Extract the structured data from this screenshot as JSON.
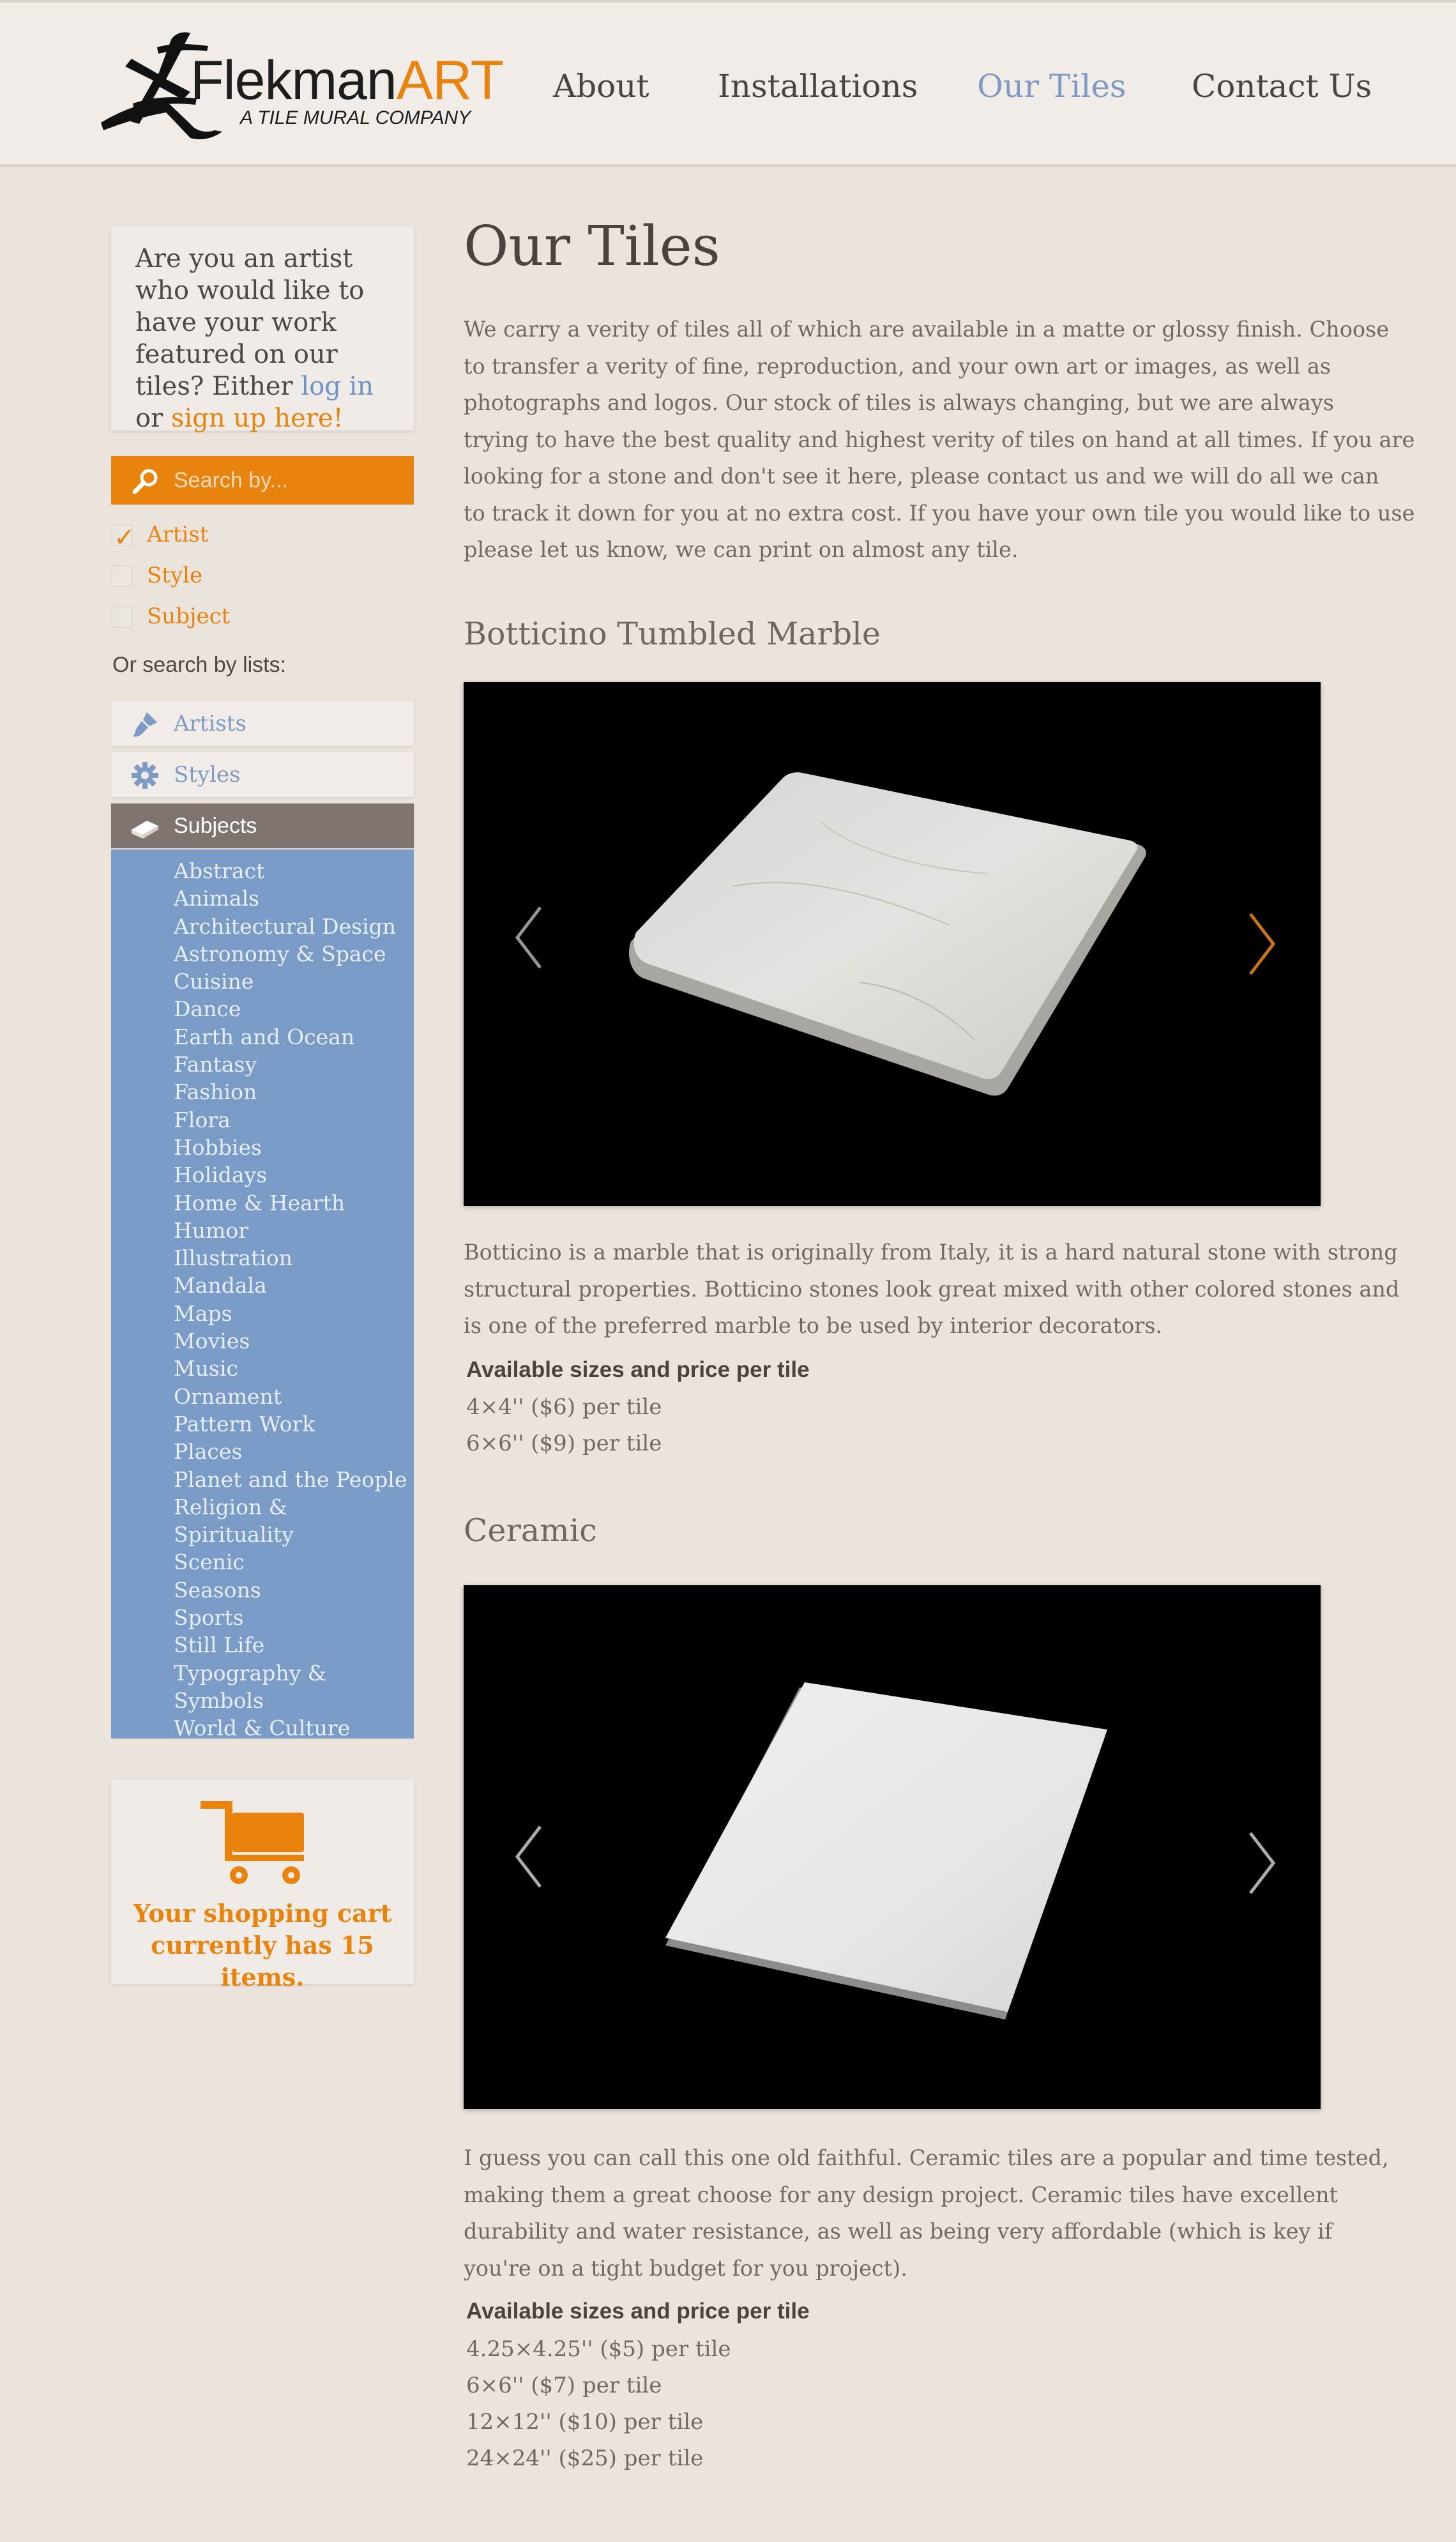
{
  "brand": {
    "name_main": "Flekman",
    "name_accent": "ART",
    "tagline": "A TILE MURAL COMPANY",
    "accent_color": "#e8830e",
    "link_color": "#7d9bc5"
  },
  "nav": {
    "items": [
      {
        "label": "About"
      },
      {
        "label": "Installations"
      },
      {
        "label": "Our Tiles",
        "active": true
      },
      {
        "label": "Contact Us"
      }
    ]
  },
  "sidebar": {
    "artist_prompt": {
      "text_before": "Are you an artist who would like to have your work featured on our tiles? Either ",
      "login_link": "log in",
      "text_middle": " or ",
      "signup_link": "sign up here",
      "text_after": "!"
    },
    "search": {
      "placeholder": "Search by...",
      "icon": "search-icon"
    },
    "filters": [
      {
        "label": "Artist",
        "checked": true
      },
      {
        "label": "Style",
        "checked": false
      },
      {
        "label": "Subject",
        "checked": false
      }
    ],
    "or_lists_label": "Or search by lists:",
    "lists": [
      {
        "label": "Artists",
        "icon": "paintbrush-icon",
        "active": false
      },
      {
        "label": "Styles",
        "icon": "gear-icon",
        "active": false
      },
      {
        "label": "Subjects",
        "icon": "book-icon",
        "active": true
      }
    ],
    "subjects": [
      "Abstract",
      "Animals",
      "Architectural Design",
      "Astronomy & Space",
      "Cuisine",
      "Dance",
      "Earth and Ocean",
      "Fantasy",
      "Fashion",
      "Flora",
      "Hobbies",
      "Holidays",
      "Home & Hearth",
      "Humor",
      "Illustration",
      "Mandala",
      "Maps",
      "Movies",
      "Music",
      "Ornament",
      "Pattern Work",
      "Places",
      "Planet and the People",
      "Religion & Spirituality",
      "Scenic",
      "Seasons",
      "Sports",
      "Still Life",
      "Typography &",
      "Symbols",
      "World & Culture"
    ],
    "cart": {
      "icon": "shopping-cart-icon",
      "line1": "Your shopping cart",
      "line2": "currently has 15 items.",
      "count": 15
    }
  },
  "main": {
    "title": "Our Tiles",
    "intro": [
      "We carry a verity of tiles all of which are available in a matte or glossy finish. Choose",
      "to transfer a verity of fine, reproduction, and your own art or images, as well as",
      "photographs and logos. Our stock of tiles is always changing, but we are always",
      "trying to have the best quality and highest verity of tiles on hand at all times. If you are",
      "looking for a stone and don't see it here, please contact us and we will do all we can",
      "to track it down for you at no extra cost. If you have your own tile you would like to use",
      "please let us know, we can print on almost any tile."
    ],
    "products": [
      {
        "name": "Botticino Tumbled Marble",
        "description": [
          "Botticino is a marble that is originally from Italy, it is a hard natural stone with strong",
          "structural properties. Botticino stones look great mixed with other colored stones and",
          "is one of the preferred marble to be used by interior decorators."
        ],
        "sizes_heading": "Available sizes and price per tile",
        "sizes": [
          "4×4'' ($6) per tile",
          "6×6'' ($9) per tile"
        ]
      },
      {
        "name": "Ceramic",
        "description": [
          "I guess you can call this one old faithful. Ceramic tiles are a popular and time tested,",
          "making them a great choose for any design project. Ceramic tiles have excellent",
          "durability and water resistance, as well as being very affordable (which is key if",
          "you're on a tight budget for you project)."
        ],
        "sizes_heading": "Available sizes and price per tile",
        "sizes": [
          "4.25×4.25'' ($5) per tile",
          "6×6'' ($7) per tile",
          "12×12'' ($10) per tile",
          "24×24'' ($25) per tile"
        ]
      }
    ]
  }
}
